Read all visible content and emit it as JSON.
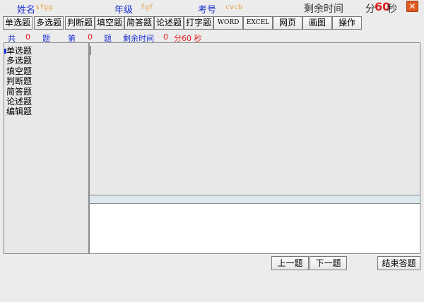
{
  "header": {
    "name_label": "姓名",
    "name_value": "sfgg",
    "grade_label": "年级",
    "grade_value": "fgf",
    "examno_label": "考号",
    "examno_value": "cvcb",
    "time_label": "剩余时间",
    "time_min_label": "分",
    "time_value": "60",
    "time_sec_label": "秒",
    "close_glyph": "✕"
  },
  "toolbar": {
    "buttons": [
      "单选题",
      "多选题",
      "判断题",
      "填空题",
      "简答题",
      "论述题",
      "打字题",
      "WORD",
      "EXCEL",
      "网页",
      "画图",
      "操作"
    ]
  },
  "info": {
    "total_label": "共",
    "total_value": "0",
    "total_unit": "题",
    "current_label": "第",
    "current_value": "0",
    "current_unit": "题",
    "remaining_label": "剩余时间",
    "remaining_min_value": "0",
    "remaining_text": "分60 秒"
  },
  "question_types": [
    "单选题",
    "多选题",
    "填空题",
    "判断题",
    "简答题",
    "论述题",
    "编辑题"
  ],
  "footer": {
    "prev_label": "上一题",
    "next_label": "下一题",
    "finish_label": "结束答题"
  },
  "colors": {
    "label_blue": "#1a2fd0",
    "value_orange": "#e6a23c",
    "time_red": "#e02020",
    "close_orange": "#e05a20"
  }
}
